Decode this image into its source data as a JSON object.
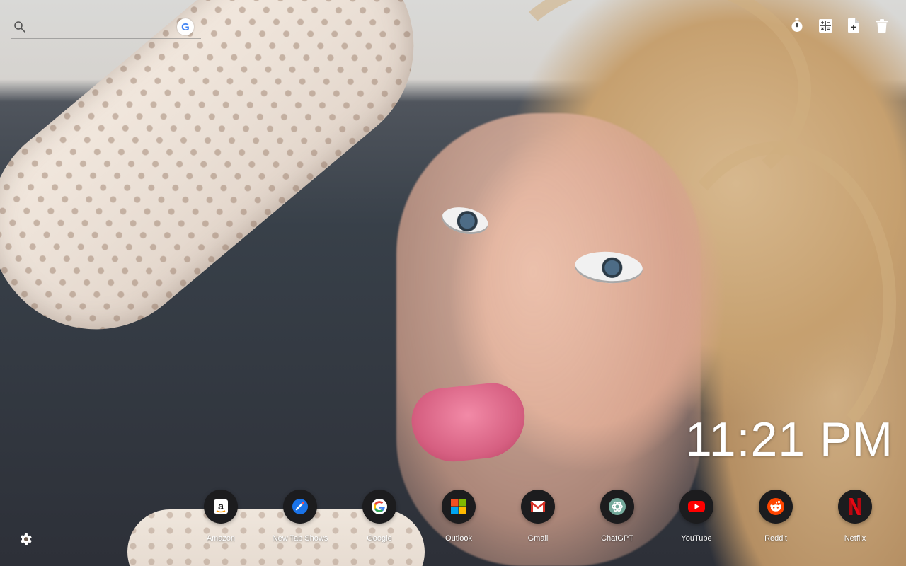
{
  "search": {
    "placeholder": "",
    "engine_icon": "google-icon",
    "engine_letter": "G"
  },
  "top_actions": [
    {
      "icon": "timer-icon"
    },
    {
      "icon": "calculator-icon"
    },
    {
      "icon": "add-note-icon"
    },
    {
      "icon": "trash-icon"
    }
  ],
  "clock": {
    "time": "11:21 PM"
  },
  "shortcuts": [
    {
      "label": "Amazon",
      "icon": "amazon-icon"
    },
    {
      "label": "New Tab Shows",
      "icon": "new-tab-icon"
    },
    {
      "label": "Google",
      "icon": "google-icon"
    },
    {
      "label": "Outlook",
      "icon": "outlook-icon"
    },
    {
      "label": "Gmail",
      "icon": "gmail-icon"
    },
    {
      "label": "ChatGPT",
      "icon": "chatgpt-icon"
    },
    {
      "label": "YouTube",
      "icon": "youtube-icon"
    },
    {
      "label": "Reddit",
      "icon": "reddit-icon"
    },
    {
      "label": "Netflix",
      "icon": "netflix-icon"
    }
  ],
  "settings": {
    "icon": "gear-icon"
  },
  "colors": {
    "text": "#ffffff",
    "shortcut_bg": "#1c1c1e",
    "youtube_red": "#ff0000",
    "netflix_red": "#e50914",
    "reddit_orange": "#ff4500",
    "chatgpt_green": "#74aa9c"
  }
}
